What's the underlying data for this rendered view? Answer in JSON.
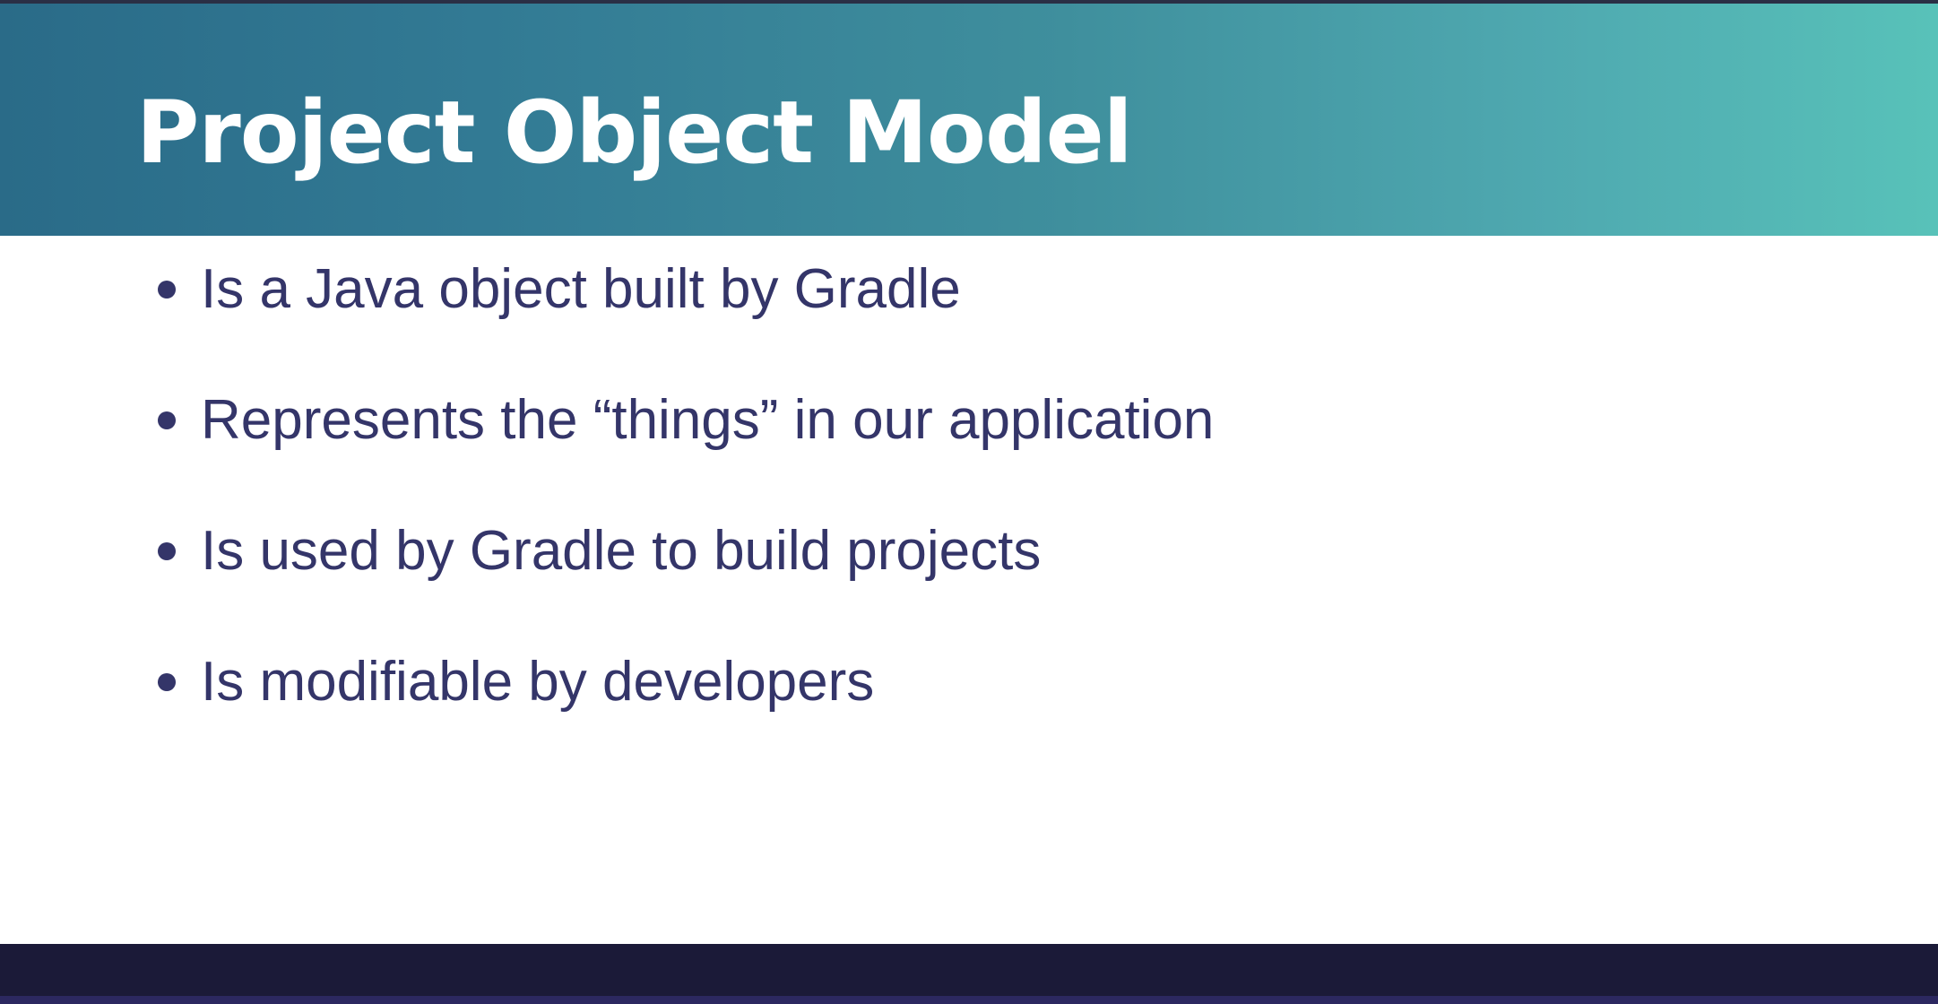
{
  "slide": {
    "title": "Project Object Model",
    "bullets": [
      "Is a Java object built by Gradle",
      "Represents the “things” in our application",
      "Is used by Gradle to build projects",
      "Is modifiable by developers"
    ]
  },
  "colors": {
    "header_gradient_start": "#2a6b88",
    "header_gradient_end": "#58c2b9",
    "title_text": "#ffffff",
    "bullet_text": "#343569",
    "background": "#ffffff",
    "footer_band": "#1b1a38"
  }
}
